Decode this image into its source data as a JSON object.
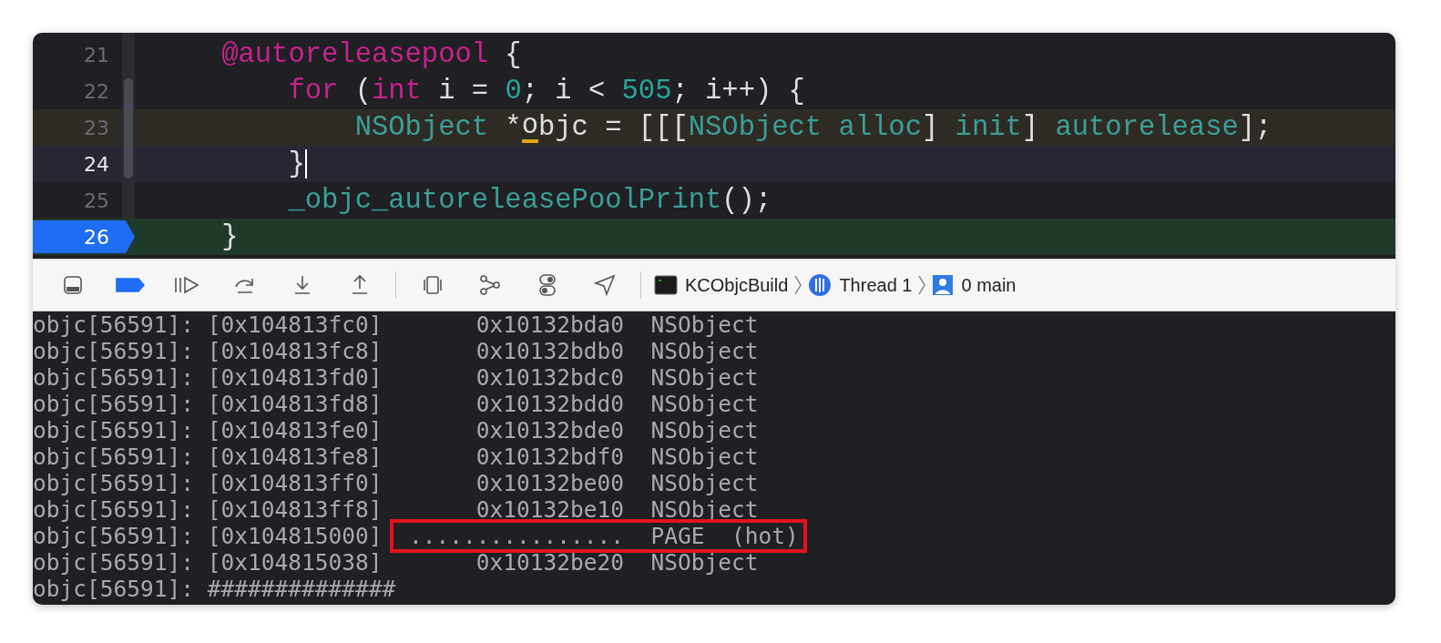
{
  "editor": {
    "lines": [
      {
        "number": "21",
        "kind": "normal",
        "tokens": [
          {
            "text": "    @autoreleasepool",
            "kind": "keyword"
          },
          {
            "text": " {",
            "kind": "plain"
          }
        ]
      },
      {
        "number": "22",
        "kind": "normal",
        "tokens": [
          {
            "text": "        for",
            "kind": "keyword"
          },
          {
            "text": " (",
            "kind": "plain"
          },
          {
            "text": "int",
            "kind": "keyword"
          },
          {
            "text": " i = ",
            "kind": "plain"
          },
          {
            "text": "0",
            "kind": "number"
          },
          {
            "text": "; i < ",
            "kind": "plain"
          },
          {
            "text": "505",
            "kind": "number"
          },
          {
            "text": "; i++) {",
            "kind": "plain"
          }
        ]
      },
      {
        "number": "23",
        "kind": "warning",
        "tokens": [
          {
            "text": "            NSObject",
            "kind": "type"
          },
          {
            "text": " *",
            "kind": "plain"
          },
          {
            "text": "o",
            "kind": "flagged"
          },
          {
            "text": "bjc = [[[",
            "kind": "plain"
          },
          {
            "text": "NSObject",
            "kind": "type"
          },
          {
            "text": " alloc",
            "kind": "type"
          },
          {
            "text": "] ",
            "kind": "plain"
          },
          {
            "text": "init",
            "kind": "type"
          },
          {
            "text": "] ",
            "kind": "plain"
          },
          {
            "text": "autorelease",
            "kind": "type"
          },
          {
            "text": "];",
            "kind": "plain"
          }
        ]
      },
      {
        "number": "24",
        "kind": "cursor",
        "tokens": [
          {
            "text": "        }",
            "kind": "plain"
          }
        ]
      },
      {
        "number": "25",
        "kind": "normal",
        "tokens": [
          {
            "text": "        _objc_autoreleasePoolPrint",
            "kind": "type"
          },
          {
            "text": "();",
            "kind": "plain"
          }
        ]
      },
      {
        "number": "26",
        "kind": "stopped",
        "tokens": [
          {
            "text": "    }",
            "kind": "plain"
          }
        ]
      }
    ]
  },
  "debug_bar": {
    "breakpoints_active": true,
    "target": "KCObjcBuild",
    "thread": "Thread 1",
    "frame": "0 main"
  },
  "console": {
    "rows": [
      {
        "prefix": "objc[56591]:",
        "slot": "[0x104813fc0]",
        "address": "0x10132bda0",
        "class": "NSObject",
        "marked": false
      },
      {
        "prefix": "objc[56591]:",
        "slot": "[0x104813fc8]",
        "address": "0x10132bdb0",
        "class": "NSObject",
        "marked": false
      },
      {
        "prefix": "objc[56591]:",
        "slot": "[0x104813fd0]",
        "address": "0x10132bdc0",
        "class": "NSObject",
        "marked": false
      },
      {
        "prefix": "objc[56591]:",
        "slot": "[0x104813fd8]",
        "address": "0x10132bdd0",
        "class": "NSObject",
        "marked": false
      },
      {
        "prefix": "objc[56591]:",
        "slot": "[0x104813fe0]",
        "address": "0x10132bde0",
        "class": "NSObject",
        "marked": false
      },
      {
        "prefix": "objc[56591]:",
        "slot": "[0x104813fe8]",
        "address": "0x10132bdf0",
        "class": "NSObject",
        "marked": false
      },
      {
        "prefix": "objc[56591]:",
        "slot": "[0x104813ff0]",
        "address": "0x10132be00",
        "class": "NSObject",
        "marked": false
      },
      {
        "prefix": "objc[56591]:",
        "slot": "[0x104813ff8]",
        "address": "0x10132be10",
        "class": "NSObject",
        "marked": false
      },
      {
        "prefix": "objc[56591]:",
        "slot": "[0x104815000]",
        "address": "................",
        "class": "PAGE  (hot)",
        "marked": true
      },
      {
        "prefix": "objc[56591]:",
        "slot": "[0x104815038]",
        "address": "0x10132be20",
        "class": "NSObject",
        "marked": false
      },
      {
        "prefix": "objc[56591]:",
        "slot": "##############",
        "marked": false
      }
    ]
  }
}
